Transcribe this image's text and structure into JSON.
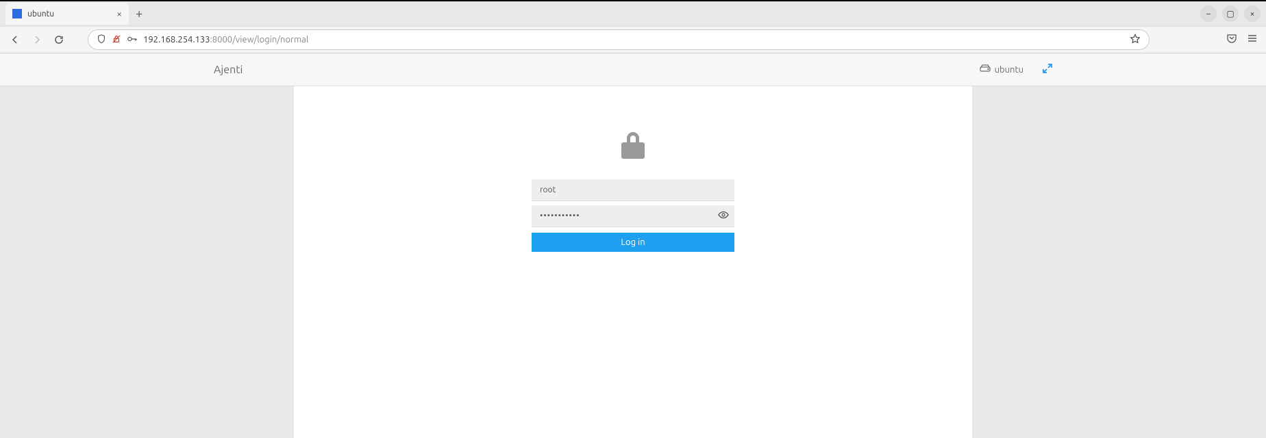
{
  "browser": {
    "tab_title": "ubuntu",
    "url_host": "192.168.254.133",
    "url_path": ":8000/view/login/normal"
  },
  "header": {
    "brand": "Ajenti",
    "hostname": "ubuntu"
  },
  "login": {
    "username_value": "root",
    "password_value": "•••••••••••",
    "button_label": "Log in"
  }
}
